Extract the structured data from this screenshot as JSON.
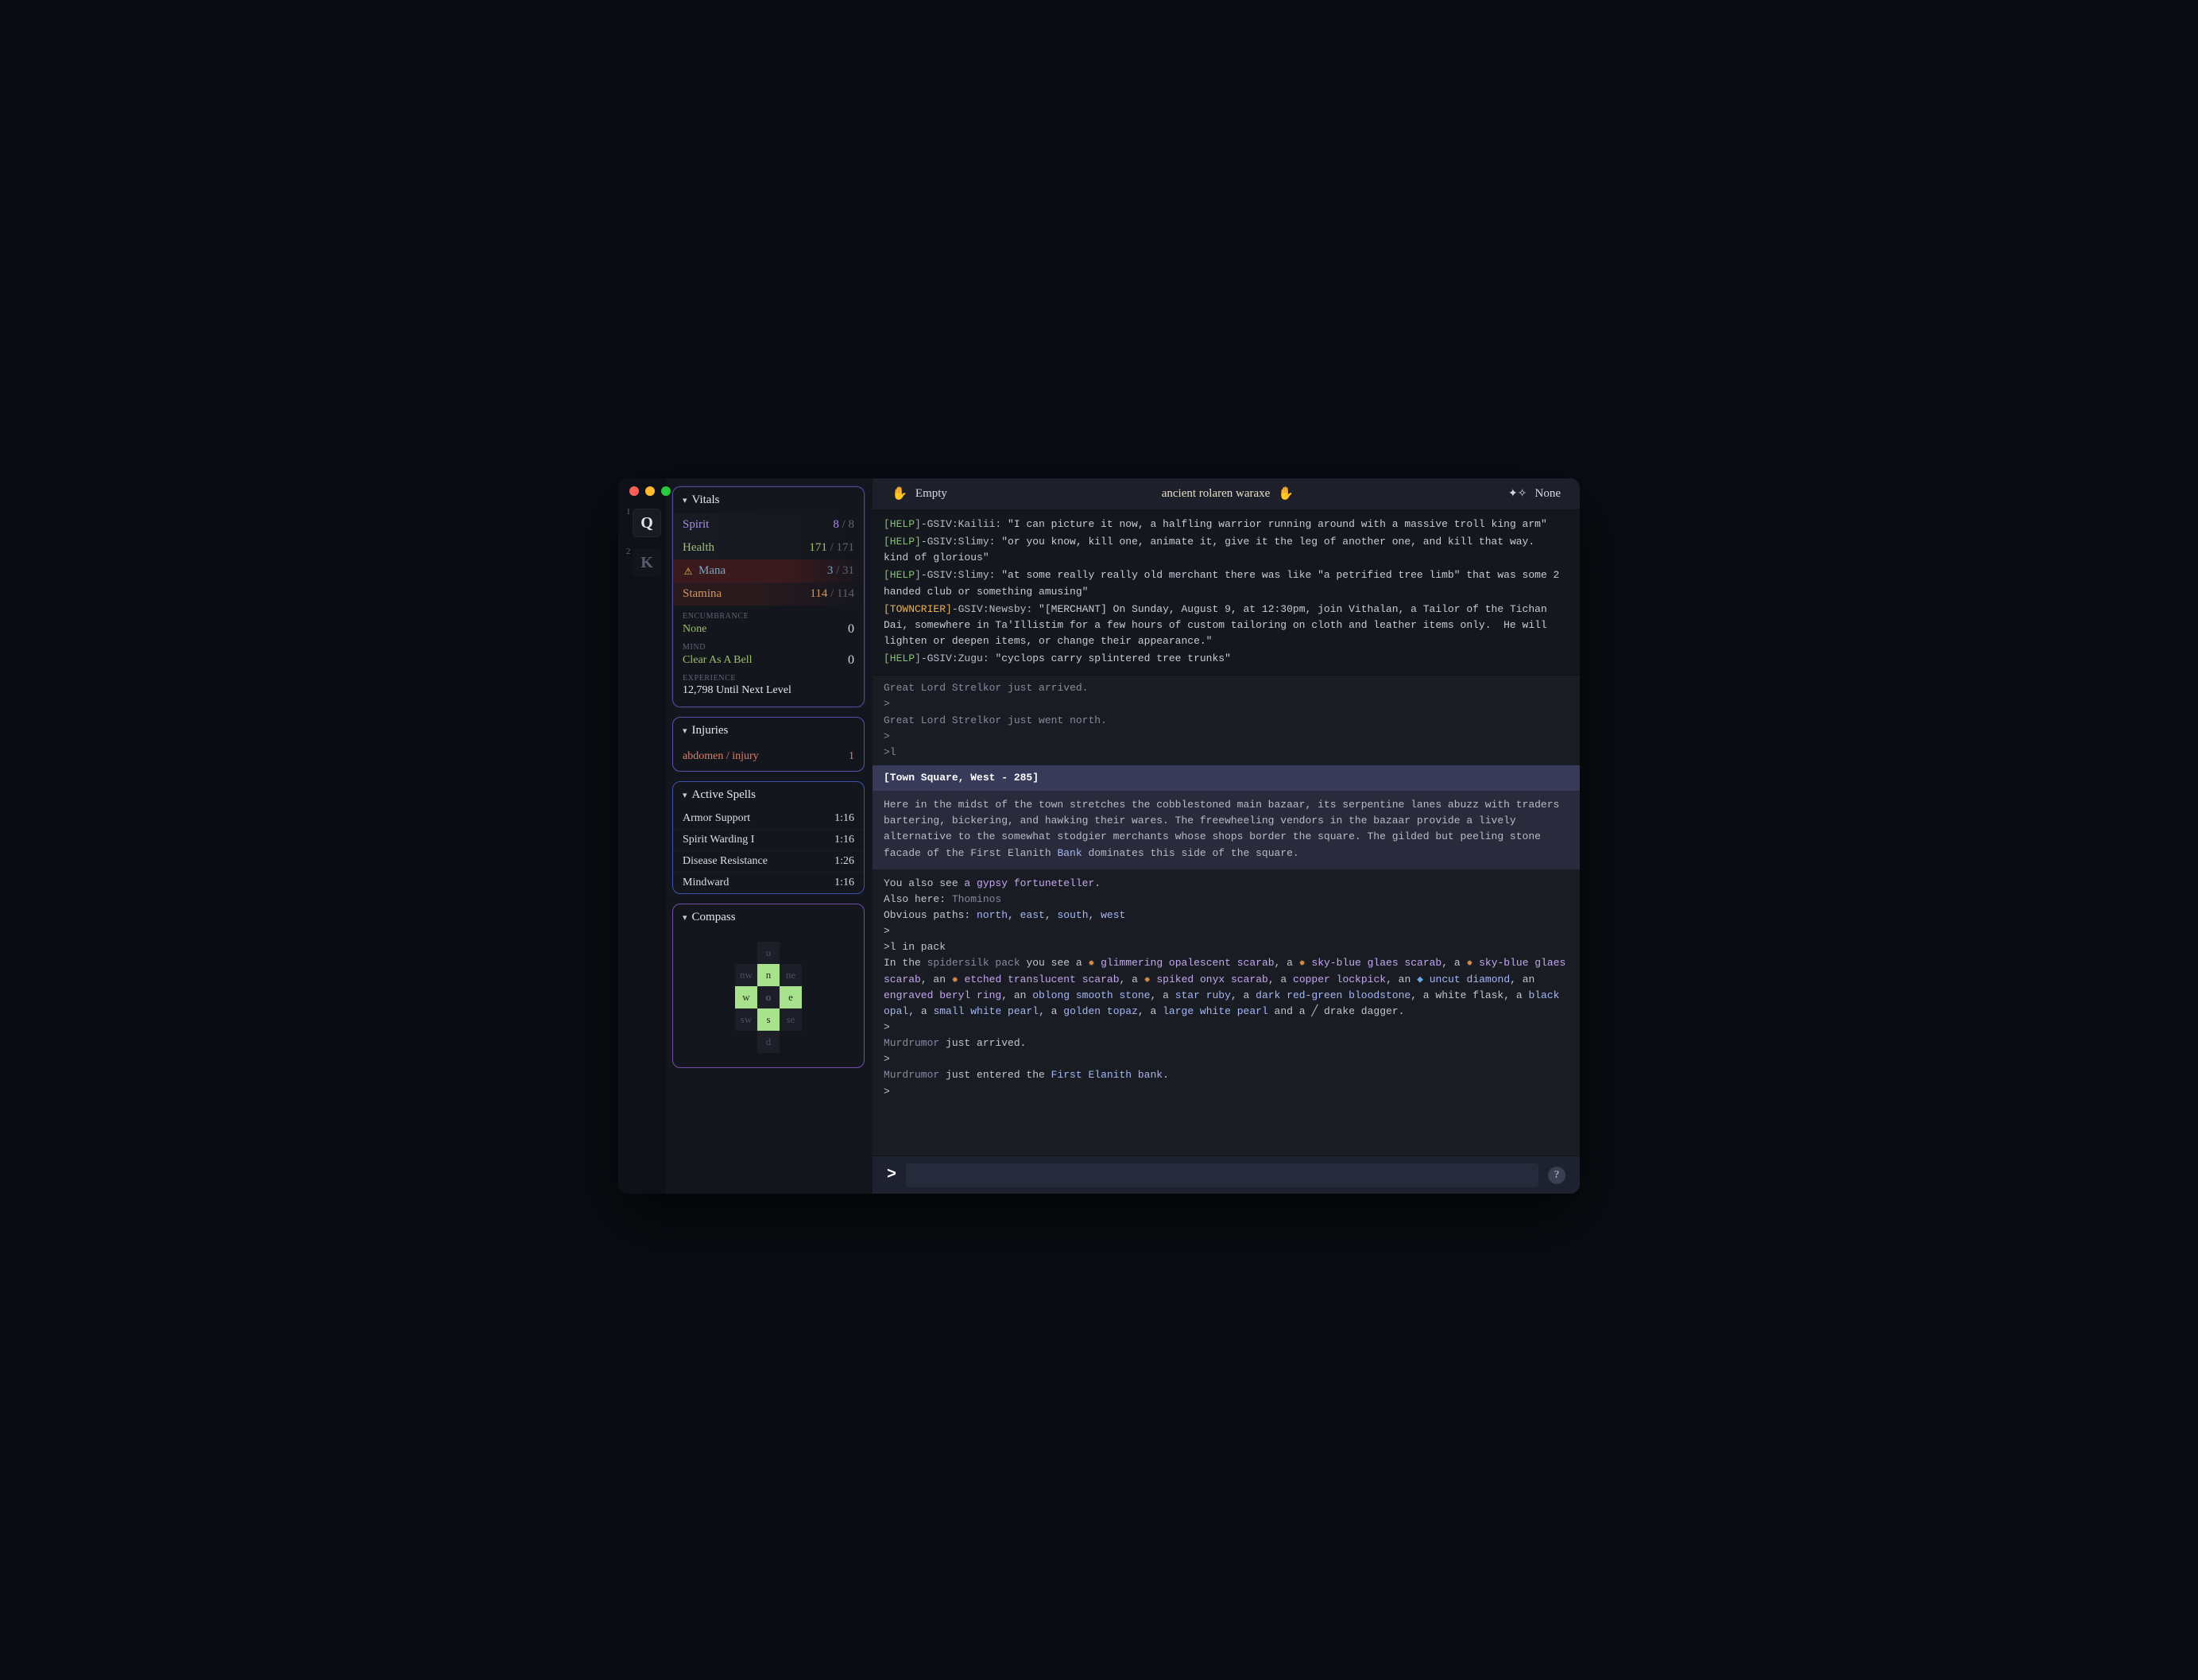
{
  "rail": {
    "items": [
      {
        "idx": "1",
        "letter": "Q",
        "active": true
      },
      {
        "idx": "2",
        "letter": "K",
        "active": false
      }
    ]
  },
  "vitals": {
    "title": "Vitals",
    "rows": {
      "spirit": {
        "label": "Spirit",
        "cur": "8",
        "max": "8"
      },
      "health": {
        "label": "Health",
        "cur": "171",
        "max": "171"
      },
      "mana": {
        "label": "Mana",
        "cur": "3",
        "max": "31",
        "warn": true
      },
      "stamina": {
        "label": "Stamina",
        "cur": "114",
        "max": "114"
      }
    },
    "encumbrance": {
      "label": "ENCUMBRANCE",
      "value": "None",
      "num": "0"
    },
    "mind": {
      "label": "MIND",
      "value": "Clear As A Bell",
      "num": "0"
    },
    "experience": {
      "label": "EXPERIENCE",
      "value": "12,798 Until Next Level"
    }
  },
  "injuries": {
    "title": "Injuries",
    "rows": [
      {
        "label": "abdomen / injury",
        "count": "1"
      }
    ]
  },
  "spells": {
    "title": "Active Spells",
    "rows": [
      {
        "name": "Armor Support",
        "time": "1:16"
      },
      {
        "name": "Spirit Warding I",
        "time": "1:16"
      },
      {
        "name": "Disease Resistance",
        "time": "1:26"
      },
      {
        "name": "Mindward",
        "time": "1:16"
      }
    ]
  },
  "compass": {
    "title": "Compass",
    "cells": {
      "u": "u",
      "nw": "nw",
      "n": "n",
      "ne": "ne",
      "w": "w",
      "o": "o",
      "e": "e",
      "sw": "sw",
      "s": "s",
      "se": "se",
      "d": "d"
    },
    "active": [
      "n",
      "w",
      "e",
      "s"
    ]
  },
  "topbar": {
    "left": {
      "label": "Empty"
    },
    "center": {
      "label": "ancient rolaren waraxe"
    },
    "right": {
      "label": "None"
    }
  },
  "chat": {
    "help": [
      {
        "tag": "[HELP]",
        "src": "-GSIV:Kailii:",
        "text": " \"I can picture it now, a halfling warrior running around with a massive troll king arm\""
      },
      {
        "tag": "[HELP]",
        "src": "-GSIV:Slimy:",
        "text": " \"or you know, kill one, animate it, give it the leg of another one, and kill that way.  kind of glorious\""
      },
      {
        "tag": "[HELP]",
        "src": "-GSIV:Slimy:",
        "text": " \"at some really really old merchant there was like \"a petrified tree limb\" that was some 2 handed club or something amusing\""
      },
      {
        "tag": "[TOWNCRIER]",
        "src": "-GSIV:Newsby:",
        "text": " \"[MERCHANT] On Sunday, August 9, at 12:30pm, join Vithalan, a Tailor of the Tichan Dai, somewhere in Ta'Illistim for a few hours of custom tailoring on cloth and leather items only.  He will lighten or deepen items, or change their appearance.\""
      },
      {
        "tag": "[HELP]",
        "src": "-GSIV:Zugu:",
        "text": " \"cyclops carry splintered tree trunks\""
      }
    ],
    "pre_room": [
      {
        "plain": "Great Lord ",
        "name": "Strelkor",
        "tail": " just arrived."
      },
      {
        "prompt": ">"
      },
      {
        "plain": "Great Lord ",
        "name": "Strelkor",
        "tail": " just went north."
      },
      {
        "prompt": ">"
      },
      {
        "prompt": ">l"
      }
    ],
    "room": {
      "header": "[Town Square, West - 285]",
      "desc": "Here in the midst of the town stretches the cobblestoned main bazaar, its serpentine lanes abuzz with traders bartering, bickering, and hawking their wares.  The freewheeling vendors in the bazaar provide a lively alternative to the somewhat stodgier merchants whose shops border the square.  The gilded but peeling stone facade of the First Elanith ",
      "bank": "Bank",
      "desc_tail": " dominates this side of the square."
    },
    "after": {
      "you_also_pre": "You also see ",
      "you_also_obj": "a gypsy fortuneteller",
      "you_also_post": ".",
      "also_here_pre": "Also here: ",
      "also_here_name": "Thominos",
      "paths_pre": "Obvious paths: ",
      "paths": [
        "north",
        "east",
        "south",
        "west"
      ],
      "cmd2": ">l in pack",
      "pack_pre": "In the ",
      "pack_name": "spidersilk pack",
      "pack_mid": " you see a ",
      "items": [
        {
          "ico": "gem",
          "text": "glimmering opalescent scarab"
        },
        {
          "sep": ", a ",
          "ico": "gem",
          "text": "sky-blue glaes scarab"
        },
        {
          "sep": ", a ",
          "ico": "gem",
          "text": "sky-blue glaes scarab"
        },
        {
          "sep": ", an ",
          "ico": "gem",
          "text": "etched translucent scarab"
        },
        {
          "sep": ", a ",
          "ico": "gem",
          "text": "spiked onyx scarab"
        },
        {
          "sep": ", a ",
          "cls": "c-lav",
          "text": "copper lockpick"
        },
        {
          "sep": ", an ",
          "ico": "diam",
          "cls": "c-link",
          "text": "uncut diamond"
        },
        {
          "sep": ", an ",
          "cls": "c-lav",
          "text": "engraved beryl ring"
        },
        {
          "sep": ", an ",
          "cls": "c-link",
          "text": "oblong smooth stone"
        },
        {
          "sep": ", a ",
          "cls": "c-link",
          "text": "star ruby"
        },
        {
          "sep": ", a ",
          "cls": "c-link",
          "text": "dark red-green bloodstone"
        },
        {
          "sep": ", a ",
          "cls": "",
          "text": "white flask"
        },
        {
          "sep": ", a ",
          "cls": "c-link",
          "text": "black opal"
        },
        {
          "sep": ", a ",
          "cls": "c-link",
          "text": "small white pearl"
        },
        {
          "sep": ", a ",
          "cls": "c-link",
          "text": "golden topaz"
        },
        {
          "sep": ", a ",
          "cls": "c-link",
          "text": "large white pearl"
        },
        {
          "sep": " and a ",
          "ico": "wand",
          "cls": "",
          "text": "drake dagger"
        }
      ],
      "pack_end": ".",
      "post": [
        {
          "prompt": ">"
        },
        {
          "name": "Murdrumor",
          "tail": " just arrived."
        },
        {
          "prompt": ">"
        },
        {
          "name": "Murdrumor",
          "tail": " just entered the ",
          "link": "First Elanith bank",
          "tail2": "."
        },
        {
          "prompt": ">"
        }
      ]
    }
  },
  "input": {
    "placeholder": ""
  }
}
